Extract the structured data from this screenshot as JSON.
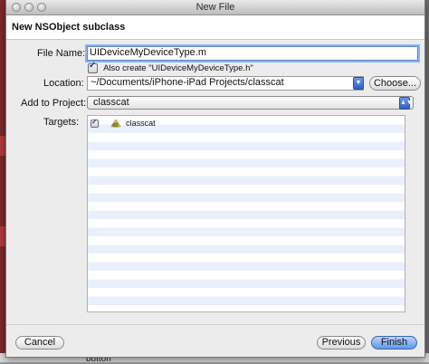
{
  "window": {
    "title": "New File"
  },
  "header": {
    "heading": "New NSObject subclass"
  },
  "form": {
    "file_name_label": "File Name:",
    "file_name_value": "UIDeviceMyDeviceType.m",
    "also_create_label": "Also create \"UIDeviceMyDeviceType.h\"",
    "also_create_checked": true,
    "location_label": "Location:",
    "location_value": "~/Documents/iPhone-iPad Projects/classcat",
    "choose_label": "Choose...",
    "add_to_project_label": "Add to Project:",
    "project_value": "classcat",
    "targets_label": "Targets:"
  },
  "targets": [
    {
      "name": "classcat",
      "checked": true,
      "icon": "target-app-icon"
    }
  ],
  "buttons": {
    "cancel": "Cancel",
    "previous": "Previous",
    "finish": "Finish"
  },
  "background": {
    "partial_text": "button"
  },
  "colors": {
    "accent": "#3b6fd0",
    "row_stripe": "#eaf0fb",
    "focus_ring": "#8db3e8"
  }
}
